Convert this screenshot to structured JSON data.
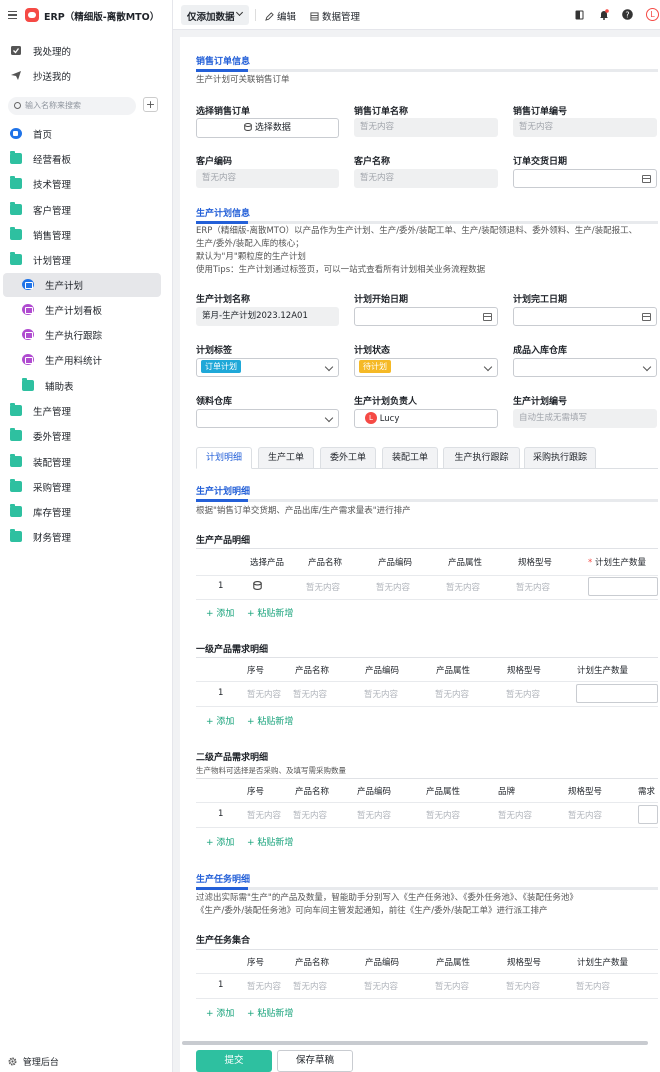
{
  "app": {
    "title": "ERP（精细版-离散MTO）",
    "admin": "管理后台"
  },
  "sidebar": {
    "top": [
      {
        "label": "我处理的"
      },
      {
        "label": "抄送我的"
      }
    ],
    "search_placeholder": "输入名称来搜索",
    "items": [
      {
        "label": "首页"
      },
      {
        "label": "经营看板"
      },
      {
        "label": "技术管理"
      },
      {
        "label": "客户管理"
      },
      {
        "label": "销售管理"
      },
      {
        "label": "计划管理"
      },
      {
        "label": "生产计划"
      },
      {
        "label": "生产计划看板"
      },
      {
        "label": "生产执行跟踪"
      },
      {
        "label": "生产用料统计"
      },
      {
        "label": "辅助表"
      },
      {
        "label": "生产管理"
      },
      {
        "label": "委外管理"
      },
      {
        "label": "装配管理"
      },
      {
        "label": "采购管理"
      },
      {
        "label": "库存管理"
      },
      {
        "label": "财务管理"
      }
    ]
  },
  "toolbar": {
    "mode": "仅添加数据",
    "edit": "编辑",
    "data_manage": "数据管理"
  },
  "form": {
    "sales_section": {
      "title": "销售订单信息",
      "desc": "生产计划可关联销售订单"
    },
    "select_order_label": "选择销售订单",
    "select_data_btn": "选择数据",
    "order_name_label": "销售订单名称",
    "order_no_label": "销售订单编号",
    "customer_code_label": "客户编码",
    "customer_name_label": "客户名称",
    "delivery_date_label": "订单交货日期",
    "empty": "暂无内容",
    "plan_section": {
      "title": "生产计划信息",
      "desc1": "ERP（精细版-离散MTO）以产品作为生产计划、生产/委外/装配工单、生产/装配领退料、委外领料、生产/装配报工、",
      "desc2": "生产/委外/装配入库的核心；",
      "desc3": "默认为\"月\"颗粒度的生产计划",
      "desc4": "使用Tips：生产计划通过标签页，可以一站式查看所有计划相关业务流程数据"
    },
    "plan_name_label": "生产计划名称",
    "plan_name_value": "第月-生产计划2023.12A01",
    "plan_start_label": "计划开始日期",
    "plan_end_label": "计划完工日期",
    "plan_tag_label": "计划标签",
    "plan_tag_value": "订单计划",
    "plan_status_label": "计划状态",
    "plan_status_value": "待计划",
    "warehouse_in_label": "成品入库仓库",
    "material_wh_label": "领料仓库",
    "owner_label": "生产计划负责人",
    "owner_value": "Lucy",
    "owner_initial": "L",
    "plan_no_label": "生产计划编号",
    "plan_no_placeholder": "自动生成无需填写"
  },
  "tabs": [
    "计划明细",
    "生产工单",
    "委外工单",
    "装配工单",
    "生产执行跟踪",
    "采购执行跟踪"
  ],
  "detail": {
    "section_title": "生产计划明细",
    "section_desc": "根据\"销售订单交货期、产品出库/生产需求量表\"进行排产",
    "t1": {
      "title": "生产产品明细",
      "headers": [
        "选择产品",
        "产品名称",
        "产品编码",
        "产品属性",
        "规格型号",
        "计划生产数量"
      ],
      "row_no": "1"
    },
    "t2": {
      "title": "一级产品需求明细",
      "headers": [
        "序号",
        "产品名称",
        "产品编码",
        "产品属性",
        "规格型号",
        "计划生产数量"
      ],
      "row_no": "1"
    },
    "t3": {
      "title": "二级产品需求明细",
      "desc": "生产物料可选择是否采购、及填写需采购数量",
      "headers": [
        "序号",
        "产品名称",
        "产品编码",
        "产品属性",
        "品牌",
        "规格型号",
        "需求"
      ],
      "row_no": "1"
    },
    "task_section": {
      "title": "生产任务明细",
      "desc1": "过滤出实际需\"生产\"的产品及数量，智能助手分别写入《生产任务池》、《委外任务池》、《装配任务池》",
      "desc2": "《生产/委外/装配任务池》可向车间主管发起通知，前往《生产/委外/装配工单》进行派工排产"
    },
    "t4": {
      "title": "生产任务集合",
      "headers": [
        "序号",
        "产品名称",
        "产品编码",
        "产品属性",
        "规格型号",
        "计划生产数量"
      ],
      "row_no": "1"
    },
    "add": "添加",
    "paste": "粘贴新增"
  },
  "footer": {
    "submit": "提交",
    "draft": "保存草稿"
  },
  "colors": {
    "accent": "#2460d8",
    "green": "#2ec0a0",
    "red": "#f54a45"
  }
}
